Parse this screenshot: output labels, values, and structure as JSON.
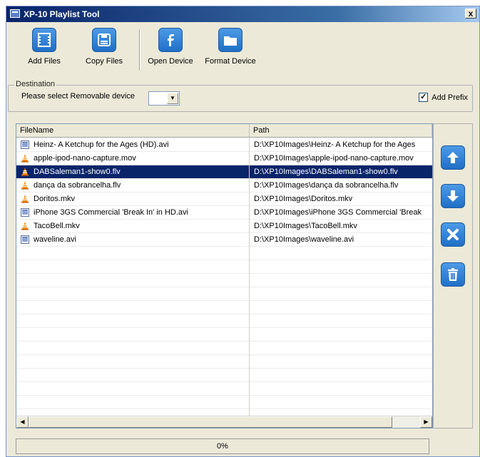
{
  "window": {
    "title": "XP-10 Playlist Tool",
    "close_label": "x"
  },
  "toolbar": {
    "add_files": {
      "label": "Add Files",
      "icon": "film-icon"
    },
    "copy_files": {
      "label": "Copy Files",
      "icon": "floppy-icon"
    },
    "open_device": {
      "label": "Open Device",
      "icon": "facebook-icon"
    },
    "format_device": {
      "label": "Format Device",
      "icon": "folder-icon"
    }
  },
  "destination": {
    "legend": "Destination",
    "label": "Please select Removable device",
    "selected_value": "",
    "add_prefix_label": "Add Prefix",
    "add_prefix_checked": true
  },
  "list": {
    "columns": [
      "FileName",
      "Path"
    ],
    "rows": [
      {
        "name": "Heinz- A Ketchup for the Ages (HD).avi",
        "path": "D:\\XP10Images\\Heinz- A Ketchup for the Ages",
        "icon": "video-file-icon",
        "selected": false
      },
      {
        "name": "apple-ipod-nano-capture.mov",
        "path": "D:\\XP10Images\\apple-ipod-nano-capture.mov",
        "icon": "vlc-cone-icon",
        "selected": false
      },
      {
        "name": "DABSaleman1-show0.flv",
        "path": "D:\\XP10Images\\DABSaleman1-show0.flv",
        "icon": "vlc-cone-icon",
        "selected": true
      },
      {
        "name": "dança da sobrancelha.flv",
        "path": "D:\\XP10Images\\dança da sobrancelha.flv",
        "icon": "vlc-cone-icon",
        "selected": false
      },
      {
        "name": "Doritos.mkv",
        "path": "D:\\XP10Images\\Doritos.mkv",
        "icon": "vlc-cone-icon",
        "selected": false
      },
      {
        "name": "iPhone 3GS Commercial 'Break In' in HD.avi",
        "path": "D:\\XP10Images\\iPhone 3GS Commercial 'Break",
        "icon": "video-file-icon",
        "selected": false
      },
      {
        "name": "TacoBell.mkv",
        "path": "D:\\XP10Images\\TacoBell.mkv",
        "icon": "vlc-cone-icon",
        "selected": false
      },
      {
        "name": "waveline.avi",
        "path": "D:\\XP10Images\\waveline.avi",
        "icon": "video-file-icon",
        "selected": false
      }
    ],
    "empty_rows": 13
  },
  "side_buttons": [
    {
      "name": "move-up-button",
      "icon": "arrow-up-icon"
    },
    {
      "name": "move-down-button",
      "icon": "arrow-down-icon"
    },
    {
      "name": "remove-button",
      "icon": "x-icon"
    },
    {
      "name": "clear-all-button",
      "icon": "trash-icon"
    }
  ],
  "progress": {
    "percent": 0,
    "label": "0%"
  },
  "colors": {
    "accent": "#1f6fc7",
    "selection": "#0a246a",
    "face": "#ece9d8"
  }
}
